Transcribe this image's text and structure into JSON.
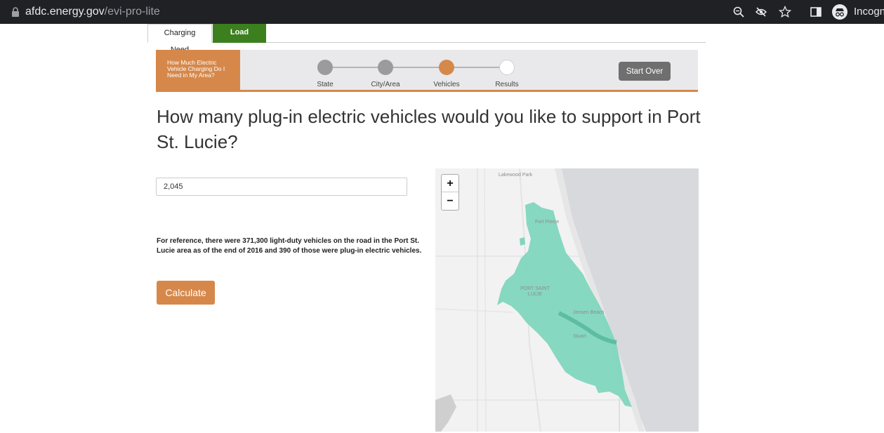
{
  "browser": {
    "host": "afdc.energy.gov",
    "path": "/evi-pro-lite",
    "incognito_label": "Incogn"
  },
  "tabs": [
    {
      "label": "Charging Need",
      "active": true
    },
    {
      "label": "Load Profile",
      "active": false
    }
  ],
  "wizard": {
    "title": "How Much Electric Vehicle Charging Do I Need in My Area?",
    "steps": [
      {
        "label": "State",
        "status": "complete"
      },
      {
        "label": "City/Area",
        "status": "complete"
      },
      {
        "label": "Vehicles",
        "status": "current"
      },
      {
        "label": "Results",
        "status": "pending"
      }
    ],
    "start_over_label": "Start Over"
  },
  "question": "How many plug-in electric vehicles would you like to support in Port St. Lucie?",
  "vehicle_input": {
    "value": "2,045"
  },
  "reference_text": "For reference, there were 371,300 light-duty vehicles on the road in the Port St. Lucie area as of the end of 2016 and 390 of those were plug-in electric vehicles.",
  "calculate_label": "Calculate",
  "map": {
    "zoom_in": "+",
    "zoom_out": "−",
    "labels": {
      "lakewood_park": "Lakewood Park",
      "fort_pierce": "Fort Pierce",
      "port_saint_lucie": "PORT SAINT LUCIE",
      "jensen_beach": "Jensen Beach",
      "stuart": "Stuart"
    }
  },
  "colors": {
    "accent_orange": "#d6884a",
    "tab_green": "#3c7f1e",
    "step_complete": "#9b9b9b",
    "region_fill": "#7fd6bd",
    "ocean": "#d7d9dc"
  }
}
